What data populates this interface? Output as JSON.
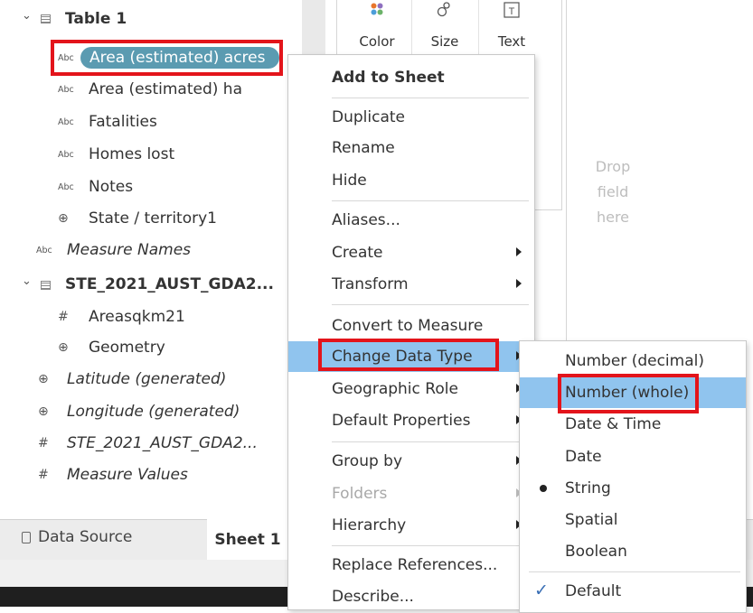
{
  "data_pane": {
    "table1": {
      "name": "Table 1"
    },
    "table1_fields": [
      {
        "type_icon": "Abc",
        "label": "Area (estimated) acres"
      },
      {
        "type_icon": "Abc",
        "label": "Area (estimated) ha"
      },
      {
        "type_icon": "Abc",
        "label": "Fatalities"
      },
      {
        "type_icon": "Abc",
        "label": "Homes lost"
      },
      {
        "type_icon": "Abc",
        "label": "Notes"
      },
      {
        "type_icon": "globe-icon",
        "label": "State / territory1"
      }
    ],
    "measure_names": {
      "type_icon": "Abc",
      "label": "Measure Names"
    },
    "table2": {
      "name": "STE_2021_AUST_GDA2..."
    },
    "table2_fields": [
      {
        "type_icon": "hash-icon",
        "label": "Areasqkm21"
      },
      {
        "type_icon": "globe-icon",
        "label": "Geometry"
      }
    ],
    "generated_fields": [
      {
        "type_icon": "globe-icon",
        "label": "Latitude (generated)"
      },
      {
        "type_icon": "globe-icon",
        "label": "Longitude (generated)"
      },
      {
        "type_icon": "hash-icon",
        "label": "STE_2021_AUST_GDA2..."
      },
      {
        "type_icon": "hash-icon",
        "label": "Measure Values"
      }
    ]
  },
  "marks_card": {
    "buttons": [
      {
        "label": "Color",
        "icon": "color-dots-icon"
      },
      {
        "label": "Size",
        "icon": "size-icon"
      },
      {
        "label": "Text",
        "icon": "text-t-icon"
      }
    ]
  },
  "drop_zone": {
    "lines": [
      "Drop",
      "field",
      "here"
    ]
  },
  "tabs": {
    "data_source": "Data Source",
    "sheet": "Sheet 1"
  },
  "context_menu": {
    "items": [
      {
        "label": "Add to Sheet"
      },
      {
        "label": "Duplicate"
      },
      {
        "label": "Rename"
      },
      {
        "label": "Hide"
      },
      {
        "label": "Aliases..."
      },
      {
        "label": "Create"
      },
      {
        "label": "Transform"
      },
      {
        "label": "Convert to Measure"
      },
      {
        "label": "Change Data Type"
      },
      {
        "label": "Geographic Role"
      },
      {
        "label": "Default Properties"
      },
      {
        "label": "Group by"
      },
      {
        "label": "Folders"
      },
      {
        "label": "Hierarchy"
      },
      {
        "label": "Replace References..."
      },
      {
        "label": "Describe..."
      }
    ]
  },
  "data_type_submenu": {
    "items": [
      {
        "label": "Number (decimal)"
      },
      {
        "label": "Number (whole)"
      },
      {
        "label": "Date & Time"
      },
      {
        "label": "Date"
      },
      {
        "label": "String"
      },
      {
        "label": "Spatial"
      },
      {
        "label": "Boolean"
      },
      {
        "label": "Default"
      }
    ],
    "selected": "String",
    "checked": "Default"
  },
  "colors": {
    "selected_pill": "#5b9bb1",
    "menu_highlight": "#90c4ee",
    "annotation_red": "#e3141b"
  }
}
